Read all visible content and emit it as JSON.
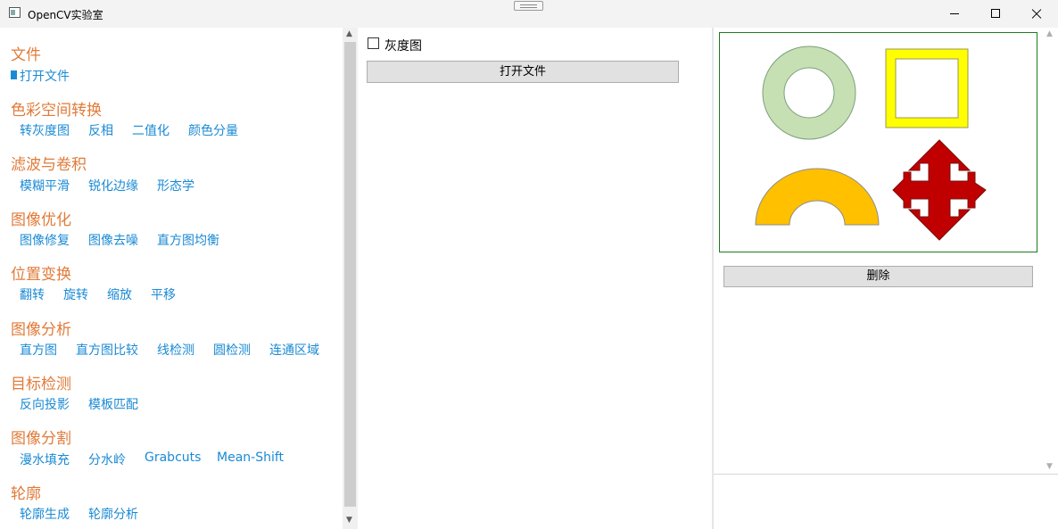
{
  "window": {
    "title": "OpenCV实验室"
  },
  "sidebar": {
    "sections": [
      {
        "title": "文件",
        "items": [
          "打开文件"
        ]
      },
      {
        "title": "色彩空间转换",
        "items": [
          "转灰度图",
          "反相",
          "二值化",
          "颜色分量"
        ]
      },
      {
        "title": "滤波与卷积",
        "items": [
          "模糊平滑",
          "锐化边缘",
          "形态学"
        ]
      },
      {
        "title": "图像优化",
        "items": [
          "图像修复",
          "图像去噪",
          "直方图均衡"
        ]
      },
      {
        "title": "位置变换",
        "items": [
          "翻转",
          "旋转",
          "缩放",
          "平移"
        ]
      },
      {
        "title": "图像分析",
        "items": [
          "直方图",
          "直方图比较",
          "线检测",
          "圆检测",
          "连通区域"
        ]
      },
      {
        "title": "目标检测",
        "items": [
          "反向投影",
          "模板匹配"
        ]
      },
      {
        "title": "图像分割",
        "items": [
          "漫水填充",
          "分水岭",
          "Grabcuts",
          "Mean-Shift"
        ]
      },
      {
        "title": "轮廓",
        "items": [
          "轮廓生成",
          "轮廓分析"
        ]
      }
    ]
  },
  "center": {
    "grayscale_label": "灰度图",
    "grayscale_checked": false,
    "open_button": "打开文件"
  },
  "right": {
    "delete_button": "删除"
  },
  "colors": {
    "section_header": "#e07b39",
    "link": "#1a8ad4",
    "image_border": "#1e7a1e",
    "ring_fill": "#c6e0b4",
    "square_fill": "#ffff00",
    "arc_fill": "#ffc000",
    "arrow_fill": "#c00000"
  },
  "icons": {
    "app": "window-icon",
    "minimize": "minimize-icon",
    "maximize": "maximize-icon",
    "close": "close-icon"
  }
}
